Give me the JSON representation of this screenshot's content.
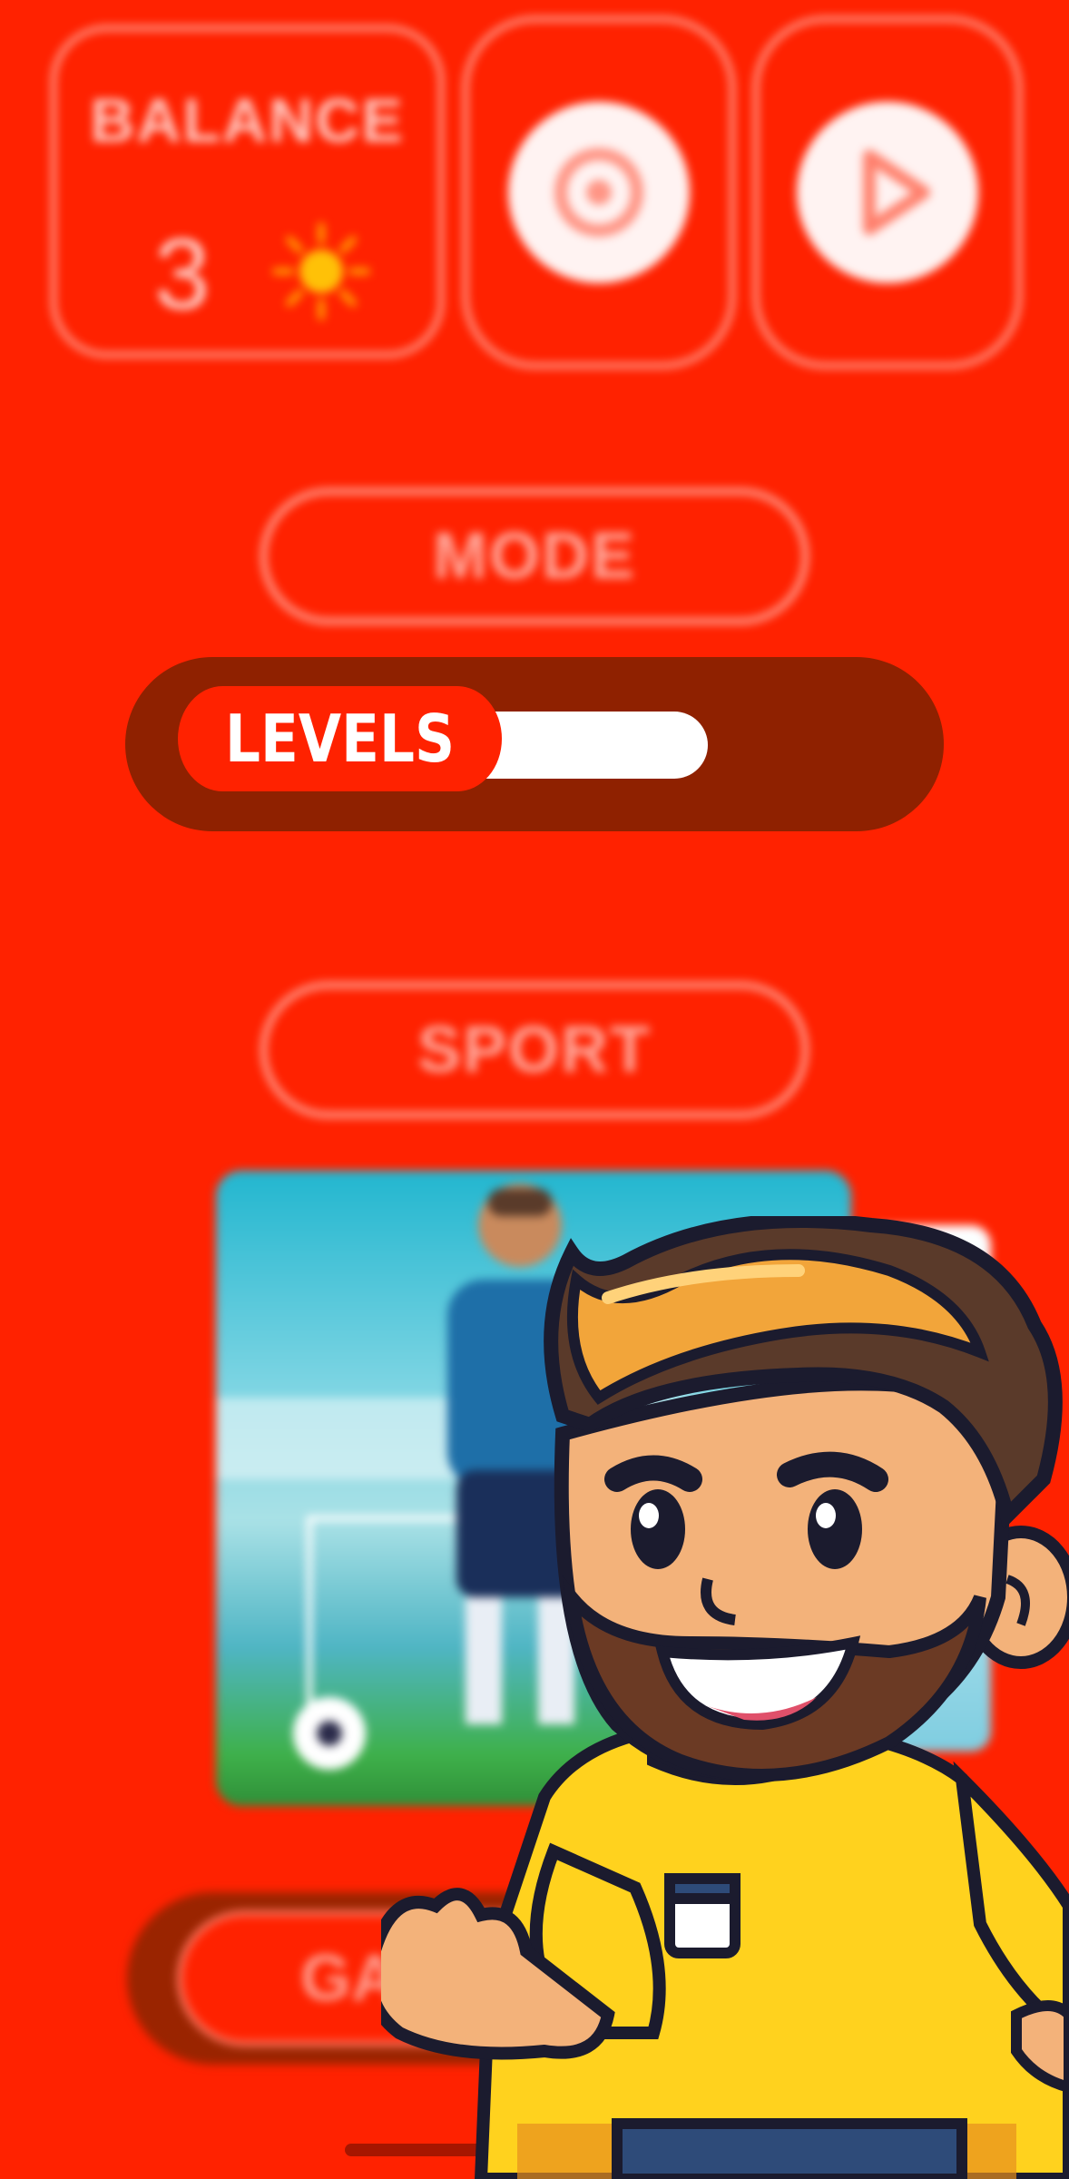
{
  "balance": {
    "label": "BALANCE",
    "value": "3",
    "currency_icon": "sun-icon"
  },
  "header": {
    "settings_icon": "gear-icon",
    "play_icon": "play-icon"
  },
  "mode": {
    "label": "MODE"
  },
  "levels": {
    "label": "LEVELS",
    "progress": 0.0
  },
  "sport": {
    "label": "SPORT",
    "image": "soccer-goalkeeper-illustration"
  },
  "game": {
    "label": "GAM"
  },
  "mascot": {
    "name": "bearded-cartoon-man"
  },
  "colors": {
    "background": "#ff2200",
    "track_dark": "#8f2100",
    "mascot_shirt": "#ffd21e",
    "mascot_hair": "#f2a53a"
  }
}
